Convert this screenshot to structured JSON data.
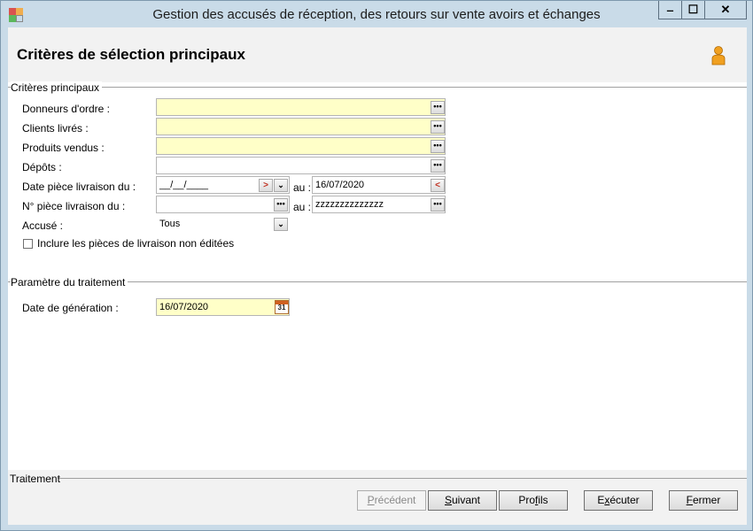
{
  "window": {
    "title": "Gestion des accusés de réception, des retours sur vente avoirs et échanges",
    "minimize_label": "‒",
    "maximize_label": "☐",
    "close_label": "✕"
  },
  "header": {
    "title": "Critères de sélection principaux",
    "user_icon": "person-icon"
  },
  "section_main": {
    "label": "Critères principaux",
    "fields": {
      "donneurs_label": "Donneurs d'ordre :",
      "clients_label": "Clients livrés :",
      "produits_label": "Produits vendus :",
      "depots_label": "Dépôts :",
      "date_du_label": "Date pièce livraison du  :",
      "date_du_value": "__/__/____",
      "date_au_label": "au :",
      "date_au_value": "16/07/2020",
      "num_du_label": "N° pièce livraison du :",
      "num_au_label": "au :",
      "num_au_value": "zzzzzzzzzzzzzz",
      "accuse_label": "Accusé :",
      "accuse_value": "Tous",
      "ellipsis": "•••",
      "nav_next": ">",
      "nav_prev": "<",
      "dropdown": "⌄"
    },
    "checkbox_label": "Inclure les pièces de livraison non éditées",
    "checkbox_checked": false
  },
  "section_params": {
    "label": "Paramètre du traitement",
    "date_label": "Date de génération :",
    "date_value": "16/07/2020",
    "calendar_day": "31"
  },
  "footer": {
    "label": "Traitement",
    "buttons": {
      "precedent_accel": "P",
      "precedent_rest": "récédent",
      "suivant_accel": "S",
      "suivant_rest": "uivant",
      "profils_pre": "Pro",
      "profils_accel": "f",
      "profils_rest": "ils",
      "executer_pre": "E",
      "executer_accel": "x",
      "executer_rest": "écuter",
      "fermer_accel": "F",
      "fermer_rest": "ermer"
    }
  },
  "colors": {
    "required_field": "#ffffc8",
    "window_frame": "#c9dbe8",
    "panel": "#f2f2f2"
  }
}
